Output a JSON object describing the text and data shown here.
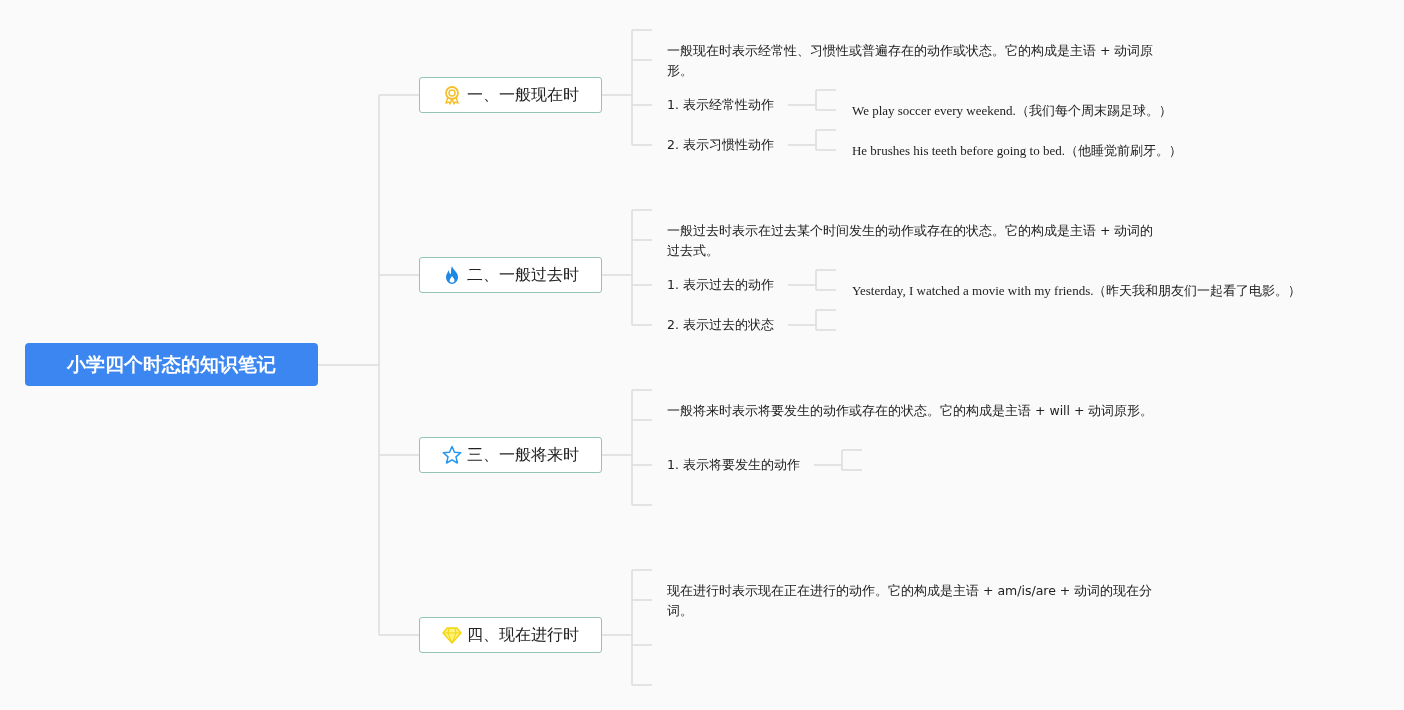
{
  "root": {
    "title": "小学四个时态的知识笔记"
  },
  "branches": [
    {
      "title": "一、一般现在时",
      "children": [
        {
          "kind": "note",
          "text": "一般现在时表示经常性、习惯性或普遍存在的动作或状态。它的构成是主语 + 动词原形。"
        },
        {
          "kind": "item",
          "text": "1. 表示经常性动作",
          "children": [
            {
              "text": "We play soccer every weekend.（我们每个周末踢足球。）"
            }
          ]
        },
        {
          "kind": "item",
          "text": "2. 表示习惯性动作",
          "children": [
            {
              "text": "He brushes his teeth before going to bed.（他睡觉前刷牙。）"
            }
          ]
        }
      ]
    },
    {
      "title": "二、一般过去时",
      "children": [
        {
          "kind": "note",
          "text": "一般过去时表示在过去某个时间发生的动作或存在的状态。它的构成是主语 + 动词的过去式。"
        },
        {
          "kind": "item",
          "text": "1. 表示过去的动作",
          "children": [
            {
              "text": "Yesterday, I watched a movie with my friends.（昨天我和朋友们一起看了电影。）"
            }
          ]
        },
        {
          "kind": "item",
          "text": "2. 表示过去的状态"
        }
      ]
    },
    {
      "title": "三、一般将来时",
      "children": [
        {
          "kind": "note",
          "text": "一般将来时表示将要发生的动作或存在的状态。它的构成是主语 + will + 动词原形。"
        },
        {
          "kind": "item",
          "text": "1. 表示将要发生的动作"
        }
      ]
    },
    {
      "title": "四、现在进行时",
      "children": [
        {
          "kind": "note",
          "text": "现在进行时表示现在正在进行的动作。它的构成是主语 + am/is/are + 动词的现在分词。"
        }
      ]
    }
  ]
}
